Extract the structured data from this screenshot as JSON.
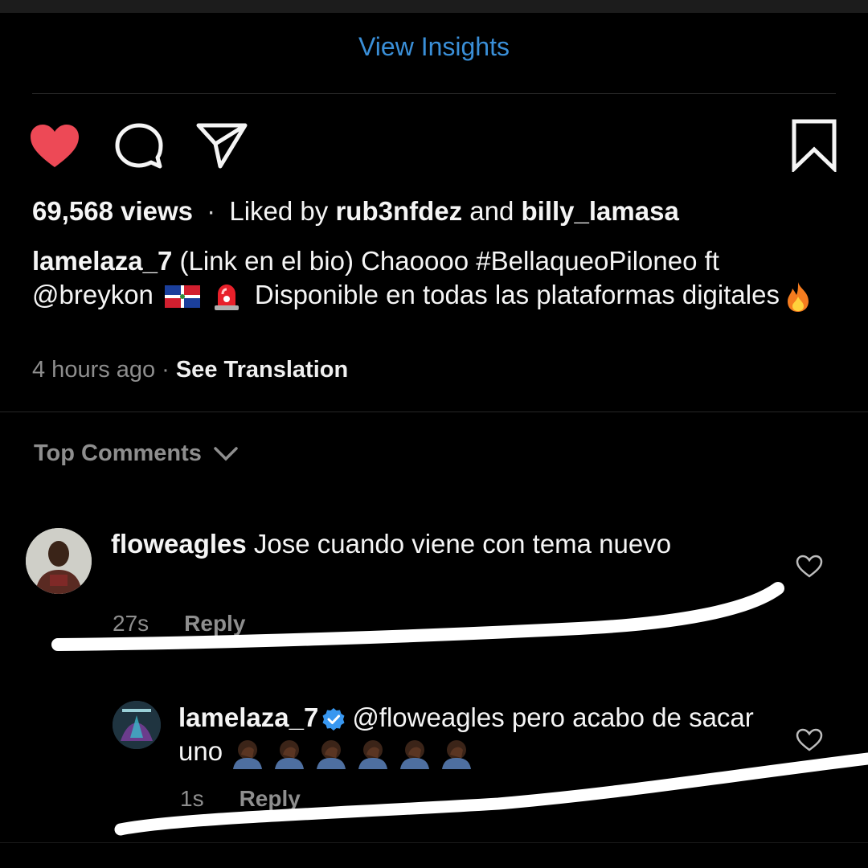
{
  "header": {
    "insights_label": "View Insights"
  },
  "actions": {
    "like_icon": "heart-filled-icon",
    "comment_icon": "comment-icon",
    "share_icon": "paper-plane-icon",
    "save_icon": "bookmark-icon",
    "like_color": "#ed4956"
  },
  "stats": {
    "views": "69,568 views",
    "separator": "·",
    "liked_by_prefix": "Liked by",
    "liked_user_1": "rub3nfdez",
    "and": "and",
    "liked_user_2": "billy_lamasa"
  },
  "caption": {
    "username": "lamelaza_7",
    "text_1": "(Link en el bio) Chaoooo #BellaqueoPiloneo ft @breykon",
    "text_2": "Disponible en todas las plataformas digitales",
    "emojis": [
      "dominican-flag",
      "siren",
      "fire"
    ]
  },
  "post_meta": {
    "time": "4 hours ago",
    "separator": "·",
    "translation": "See Translation"
  },
  "comments_section": {
    "label": "Top Comments"
  },
  "comments": [
    {
      "username": "floweagles",
      "text": "Jose cuando  viene con tema nuevo",
      "time": "27s",
      "reply_label": "Reply"
    },
    {
      "username": "lamelaza_7",
      "verified": true,
      "text": "@floweagles pero acabo de sacar uno",
      "emoji_count": 6,
      "time": "1s",
      "reply_label": "Reply"
    }
  ]
}
